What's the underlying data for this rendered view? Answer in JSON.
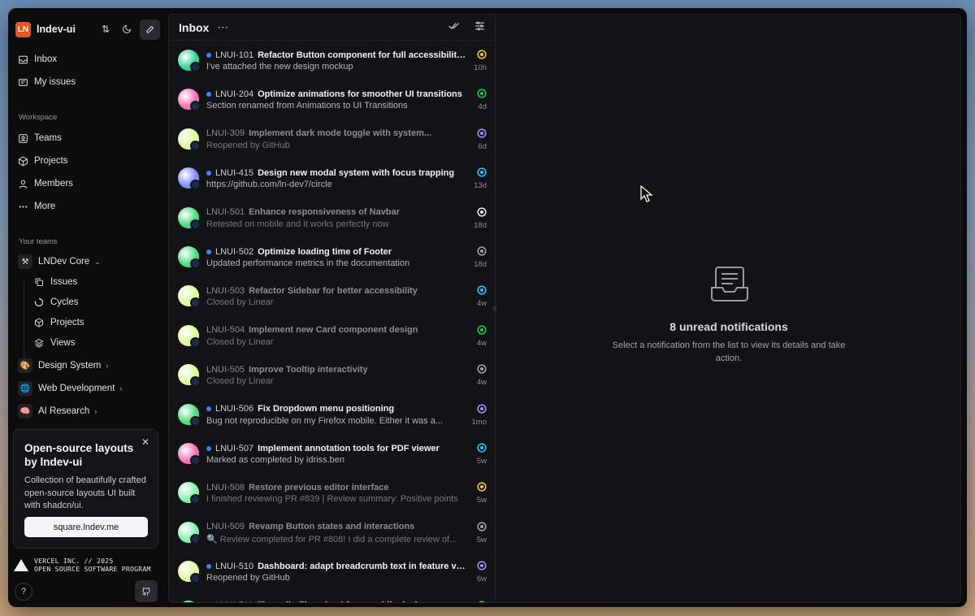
{
  "app": {
    "logo_text": "LN",
    "name": "lndev-ui"
  },
  "nav": {
    "inbox": "Inbox",
    "my_issues": "My issues"
  },
  "workspace": {
    "label": "Workspace",
    "teams": "Teams",
    "projects": "Projects",
    "members": "Members",
    "more": "More"
  },
  "your_teams": {
    "label": "Your teams",
    "core": {
      "name": "LNDev Core",
      "issues": "Issues",
      "cycles": "Cycles",
      "projects": "Projects",
      "views": "Views"
    },
    "design": "Design System",
    "web": "Web Development",
    "ai": "AI Research"
  },
  "promo": {
    "title": "Open-source layouts by lndev-ui",
    "description": "Collection of beautifully crafted open-source layouts UI built with shadcn/ui.",
    "button": "square.lndev.me"
  },
  "vercel": {
    "line1": "VERCEL INC. // 2025",
    "line2": "OPEN SOURCE SOFTWARE PROGRAM"
  },
  "inbox": {
    "title": "Inbox",
    "rows": [
      {
        "id": "LNUI-101",
        "title": "Refactor Button component for full accessibility...",
        "sub": "I've attached the new design mockup",
        "time": "10h",
        "unread": true,
        "avatar": "#34d399",
        "status": "#f5c542"
      },
      {
        "id": "LNUI-204",
        "title": "Optimize animations for smoother UI transitions",
        "sub": "Section renamed from Animations to UI Transitions",
        "time": "4d",
        "unread": true,
        "avatar": "#f472b6",
        "status": "#22c55e"
      },
      {
        "id": "LNUI-309",
        "title": "Implement dark mode toggle with system...",
        "sub": "Reopened by GitHub",
        "time": "6d",
        "unread": false,
        "avatar": "#d9f99d",
        "status": "#a78bfa"
      },
      {
        "id": "LNUI-415",
        "title": "Design new modal system with focus trapping",
        "sub": "https://github.com/ln-dev7/circle",
        "time": "13d",
        "unread": true,
        "avatar": "#818cf8",
        "status": "#38bdf8"
      },
      {
        "id": "LNUI-501",
        "title": "Enhance responsiveness of Navbar",
        "sub": "Retested on mobile and it works perfectly now",
        "time": "18d",
        "unread": false,
        "avatar": "#4ade80",
        "status": "#e5e5e5"
      },
      {
        "id": "LNUI-502",
        "title": "Optimize loading time of Footer",
        "sub": "Updated performance metrics in the documentation",
        "time": "18d",
        "unread": true,
        "avatar": "#4ade80",
        "status": "#9ca3af"
      },
      {
        "id": "LNUI-503",
        "title": "Refactor Sidebar for better accessibility",
        "sub": "Closed by Linear",
        "time": "4w",
        "unread": false,
        "avatar": "#d9f99d",
        "status": "#38bdf8"
      },
      {
        "id": "LNUI-504",
        "title": "Implement new Card component design",
        "sub": "Closed by Linear",
        "time": "4w",
        "unread": false,
        "avatar": "#d9f99d",
        "status": "#22c55e"
      },
      {
        "id": "LNUI-505",
        "title": "Improve Tooltip interactivity",
        "sub": "Closed by Linear",
        "time": "4w",
        "unread": false,
        "avatar": "#d9f99d",
        "status": "#9ca3af"
      },
      {
        "id": "LNUI-506",
        "title": "Fix Dropdown menu positioning",
        "sub": "Bug not reproducible on my Firefox mobile. Either it was a...",
        "time": "1mo",
        "unread": true,
        "avatar": "#4ade80",
        "status": "#a78bfa"
      },
      {
        "id": "LNUI-507",
        "title": "Implement annotation tools for PDF viewer",
        "sub": "Marked as completed by idriss.ben",
        "time": "5w",
        "unread": true,
        "avatar": "#f472b6",
        "status": "#38bdf8"
      },
      {
        "id": "LNUI-508",
        "title": "Restore previous editor interface",
        "sub": "I finished reviewing PR #839 | Review summary: Positive points",
        "time": "5w",
        "unread": false,
        "avatar": "#86efac",
        "status": "#f5c542"
      },
      {
        "id": "LNUI-509",
        "title": "Revamp Button states and interactions",
        "sub": "🔍 Review completed for PR #808! I did a complete review of...",
        "time": "5w",
        "unread": false,
        "avatar": "#86efac",
        "status": "#9ca3af"
      },
      {
        "id": "LNUI-510",
        "title": "Dashboard: adapt breadcrumb text in feature view",
        "sub": "Reopened by GitHub",
        "time": "6w",
        "unread": true,
        "avatar": "#d9f99d",
        "status": "#a78bfa"
      },
      {
        "id": "LNUI-511",
        "title": "Fix audio file upload from mobile devices",
        "sub": "",
        "time": "",
        "unread": true,
        "avatar": "#4ade80",
        "status": "#22c55e"
      }
    ]
  },
  "detail": {
    "empty_title": "8 unread notifications",
    "empty_desc": "Select a notification from the list to view its details and take action."
  }
}
